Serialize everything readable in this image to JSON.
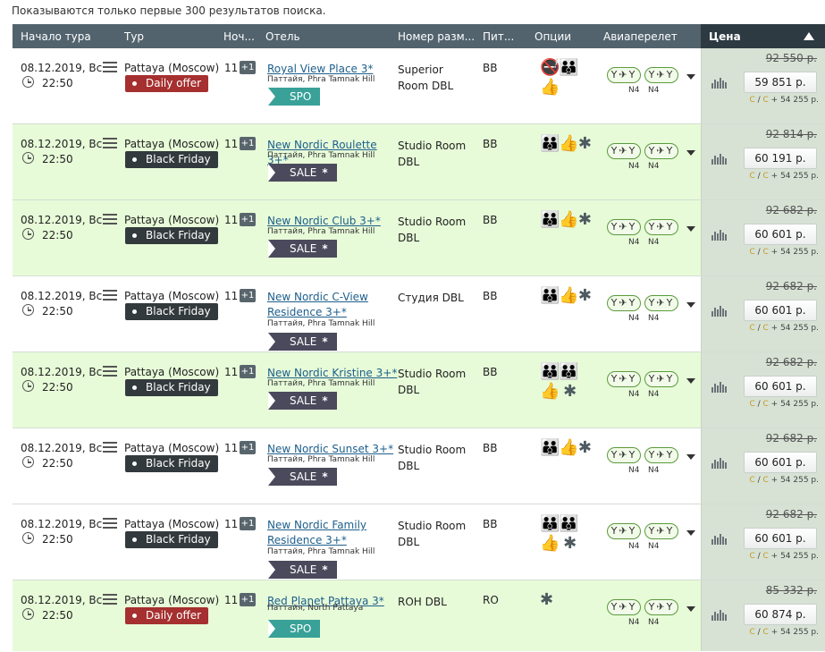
{
  "notice": "Показываются только первые 300 результатов поиска.",
  "header": {
    "start": "Начало тура",
    "tour": "Тур",
    "nights": "Ноч...",
    "hotel": "Отель",
    "room": "Номер разм...",
    "meal": "Пит...",
    "options": "Опции",
    "flight": "Авиаперелет",
    "price": "Цена"
  },
  "flight_label": "N4",
  "flight_pill": "✈",
  "rows": [
    {
      "date": "08.12.2019, Вс",
      "time": "22:50",
      "tour": "Pattaya (Moscow)",
      "badge": "Daily offer",
      "badge_color": "red",
      "nights": "11",
      "plus": "+1",
      "hotel": "Royal View Place 3*",
      "location": "Паттайя, Phra Tamnak Hill",
      "tag": "SPO",
      "tag_type": "spo",
      "room": "Superior Room DBL",
      "meal": "BB",
      "options": "🚭👪👍",
      "old_price": "92 550 р.",
      "price": "59 851 р.",
      "extra": "+ 54 255 р."
    },
    {
      "date": "08.12.2019, Вс",
      "time": "22:50",
      "tour": "Pattaya (Moscow)",
      "badge": "Black Friday",
      "badge_color": "dark",
      "nights": "11",
      "plus": "+1",
      "hotel": "New Nordic Roulette 3+*",
      "location": "Паттайя, Phra Tamnak Hill",
      "tag": "SALE",
      "tag_type": "sale",
      "room": "Studio Room DBL",
      "meal": "BB",
      "options": "👪👍✱",
      "old_price": "92 814 р.",
      "price": "60 191 р.",
      "extra": "+ 54 255 р."
    },
    {
      "date": "08.12.2019, Вс",
      "time": "22:50",
      "tour": "Pattaya (Moscow)",
      "badge": "Black Friday",
      "badge_color": "dark",
      "nights": "11",
      "plus": "+1",
      "hotel": "New Nordic Club 3+*",
      "location": "Паттайя, Phra Tamnak Hill",
      "tag": "SALE",
      "tag_type": "sale",
      "room": "Studio Room DBL",
      "meal": "BB",
      "options": "👪👍✱",
      "old_price": "92 682 р.",
      "price": "60 601 р.",
      "extra": "+ 54 255 р."
    },
    {
      "date": "08.12.2019, Вс",
      "time": "22:50",
      "tour": "Pattaya (Moscow)",
      "badge": "Black Friday",
      "badge_color": "dark",
      "nights": "11",
      "plus": "+1",
      "hotel": "New Nordic C-View Residence 3+*",
      "location": "Паттайя, Phra Tamnak Hill",
      "tag": "SALE",
      "tag_type": "sale",
      "room": "Студия DBL",
      "meal": "BB",
      "options": "👪👍✱",
      "old_price": "92 682 р.",
      "price": "60 601 р.",
      "extra": "+ 54 255 р."
    },
    {
      "date": "08.12.2019, Вс",
      "time": "22:50",
      "tour": "Pattaya (Moscow)",
      "badge": "Black Friday",
      "badge_color": "dark",
      "nights": "11",
      "plus": "+1",
      "hotel": "New Nordic Kristine 3+*",
      "location": "Паттайя, Phra Tamnak Hill",
      "tag": "SALE",
      "tag_type": "sale",
      "room": "Studio Room DBL",
      "meal": "BB",
      "options": "👪👪👍 ✱",
      "old_price": "92 682 р.",
      "price": "60 601 р.",
      "extra": "+ 54 255 р."
    },
    {
      "date": "08.12.2019, Вс",
      "time": "22:50",
      "tour": "Pattaya (Moscow)",
      "badge": "Black Friday",
      "badge_color": "dark",
      "nights": "11",
      "plus": "+1",
      "hotel": "New Nordic Sunset 3+*",
      "location": "Паттайя, Phra Tamnak Hill",
      "tag": "SALE",
      "tag_type": "sale",
      "room": "Studio Room DBL",
      "meal": "BB",
      "options": "👪👍✱",
      "old_price": "92 682 р.",
      "price": "60 601 р.",
      "extra": "+ 54 255 р."
    },
    {
      "date": "08.12.2019, Вс",
      "time": "22:50",
      "tour": "Pattaya (Moscow)",
      "badge": "Black Friday",
      "badge_color": "dark",
      "nights": "11",
      "plus": "+1",
      "hotel": "New Nordic Family Residence 3+*",
      "location": "Паттайя, Phra Tamnak Hill",
      "tag": "SALE",
      "tag_type": "sale",
      "room": "Studio Room DBL",
      "meal": "BB",
      "options": "👪👪👍 ✱",
      "old_price": "92 682 р.",
      "price": "60 601 р.",
      "extra": "+ 54 255 р."
    },
    {
      "date": "08.12.2019, Вс",
      "time": "22:50",
      "tour": "Pattaya (Moscow)",
      "badge": "Daily offer",
      "badge_color": "red",
      "nights": "11",
      "plus": "+1",
      "hotel": "Red Planet Pattaya 3*",
      "location": "Паттайя, North Pattaya",
      "tag": "SPO",
      "tag_type": "spo",
      "room": "ROH DBL",
      "meal": "RO",
      "options": "✱",
      "old_price": "85 332 р.",
      "price": "60 874 р.",
      "extra": "+ 54 255 р."
    }
  ]
}
